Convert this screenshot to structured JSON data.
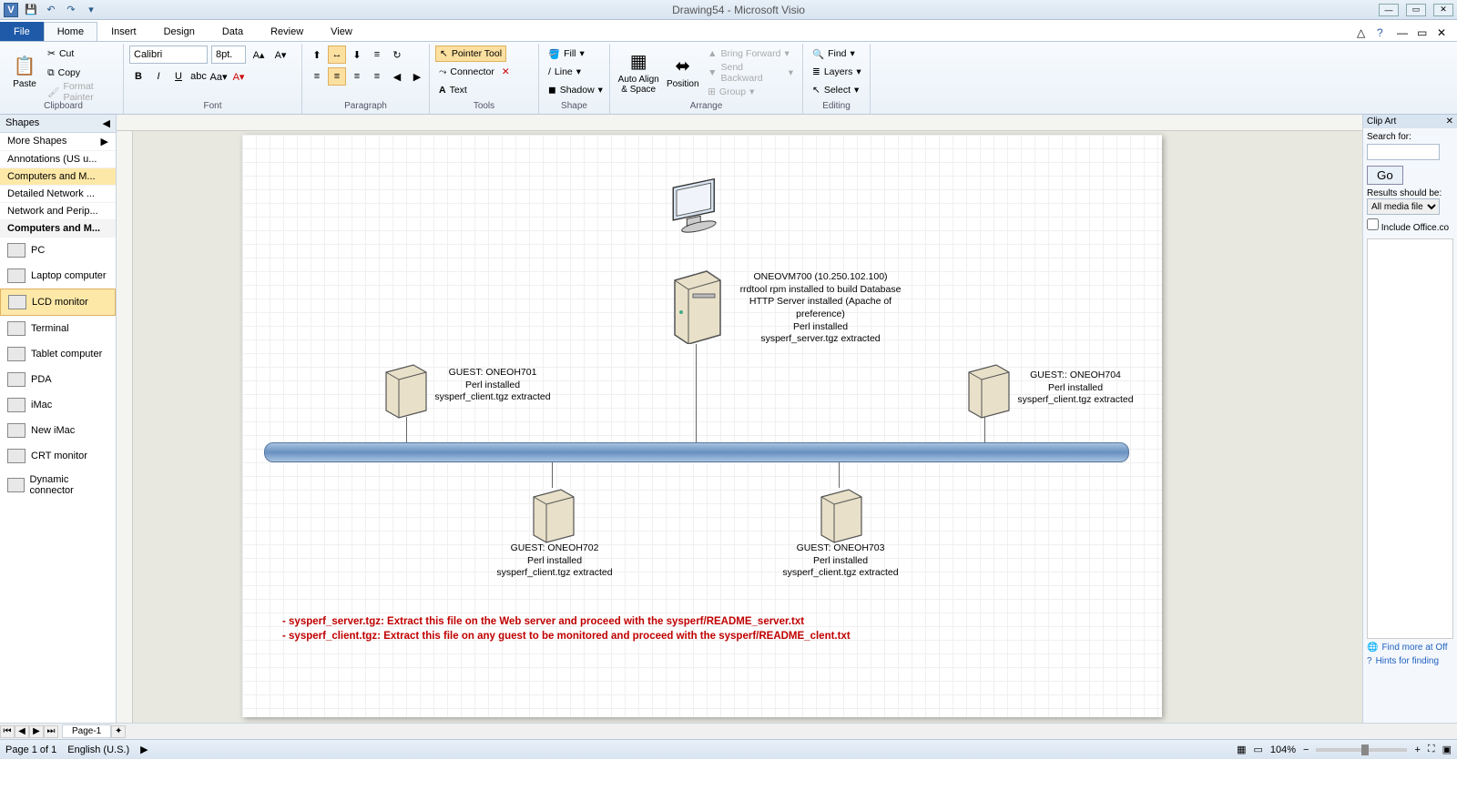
{
  "app": {
    "title": "Drawing54 - Microsoft Visio"
  },
  "tabs": {
    "file": "File",
    "home": "Home",
    "insert": "Insert",
    "design": "Design",
    "data": "Data",
    "review": "Review",
    "view": "View"
  },
  "ribbon": {
    "clipboard": {
      "label": "Clipboard",
      "paste": "Paste",
      "cut": "Cut",
      "copy": "Copy",
      "format_painter": "Format Painter"
    },
    "font": {
      "label": "Font",
      "name": "Calibri",
      "size": "8pt."
    },
    "paragraph": {
      "label": "Paragraph"
    },
    "tools": {
      "label": "Tools",
      "pointer": "Pointer Tool",
      "connector": "Connector",
      "text": "Text"
    },
    "shape": {
      "label": "Shape",
      "fill": "Fill",
      "line": "Line",
      "shadow": "Shadow"
    },
    "arrange": {
      "label": "Arrange",
      "autoalign": "Auto Align & Space",
      "position": "Position",
      "bring_forward": "Bring Forward",
      "send_backward": "Send Backward",
      "group": "Group"
    },
    "editing": {
      "label": "Editing",
      "find": "Find",
      "layers": "Layers",
      "select": "Select"
    }
  },
  "shapes_pane": {
    "header": "Shapes",
    "more_shapes": "More Shapes",
    "stencils": [
      "Annotations (US u...",
      "Computers and M...",
      "Detailed Network ...",
      "Network and Perip..."
    ],
    "title": "Computers and M...",
    "items": [
      "PC",
      "Laptop computer",
      "LCD monitor",
      "Terminal",
      "Tablet computer",
      "PDA",
      "iMac",
      "New iMac",
      "CRT monitor",
      "Dynamic connector"
    ]
  },
  "diagram": {
    "server_main": {
      "line1": "ONEOVM700 (10.250.102.100)",
      "line2": "rrdtool rpm installed to build Database",
      "line3": "HTTP Server installed (Apache of preference)",
      "line4": "Perl installed",
      "line5": "sysperf_server.tgz extracted"
    },
    "guest1": {
      "line1": "GUEST: ONEOH701",
      "line2": "Perl installed",
      "line3": "sysperf_client.tgz extracted"
    },
    "guest2": {
      "line1": "GUEST: ONEOH702",
      "line2": "Perl installed",
      "line3": "sysperf_client.tgz extracted"
    },
    "guest3": {
      "line1": "GUEST: ONEOH703",
      "line2": "Perl installed",
      "line3": "sysperf_client.tgz extracted"
    },
    "guest4": {
      "line1": "GUEST:: ONEOH704",
      "line2": "Perl installed",
      "line3": "sysperf_client.tgz extracted"
    },
    "note1": "- sysperf_server.tgz: Extract this file on the Web server and proceed with the sysperf/README_server.txt",
    "note2": "- sysperf_client.tgz: Extract this file on any guest to be monitored and proceed with the   sysperf/README_clent.txt"
  },
  "clipart": {
    "header": "Clip Art",
    "search_label": "Search for:",
    "go": "Go",
    "results_label": "Results should be:",
    "media_type": "All media file t",
    "include_office": "Include Office.co",
    "find_more": "Find more at Off",
    "hints": "Hints for finding"
  },
  "page_tab": "Page-1",
  "status": {
    "page": "Page 1 of 1",
    "lang": "English (U.S.)",
    "zoom": "104%"
  }
}
